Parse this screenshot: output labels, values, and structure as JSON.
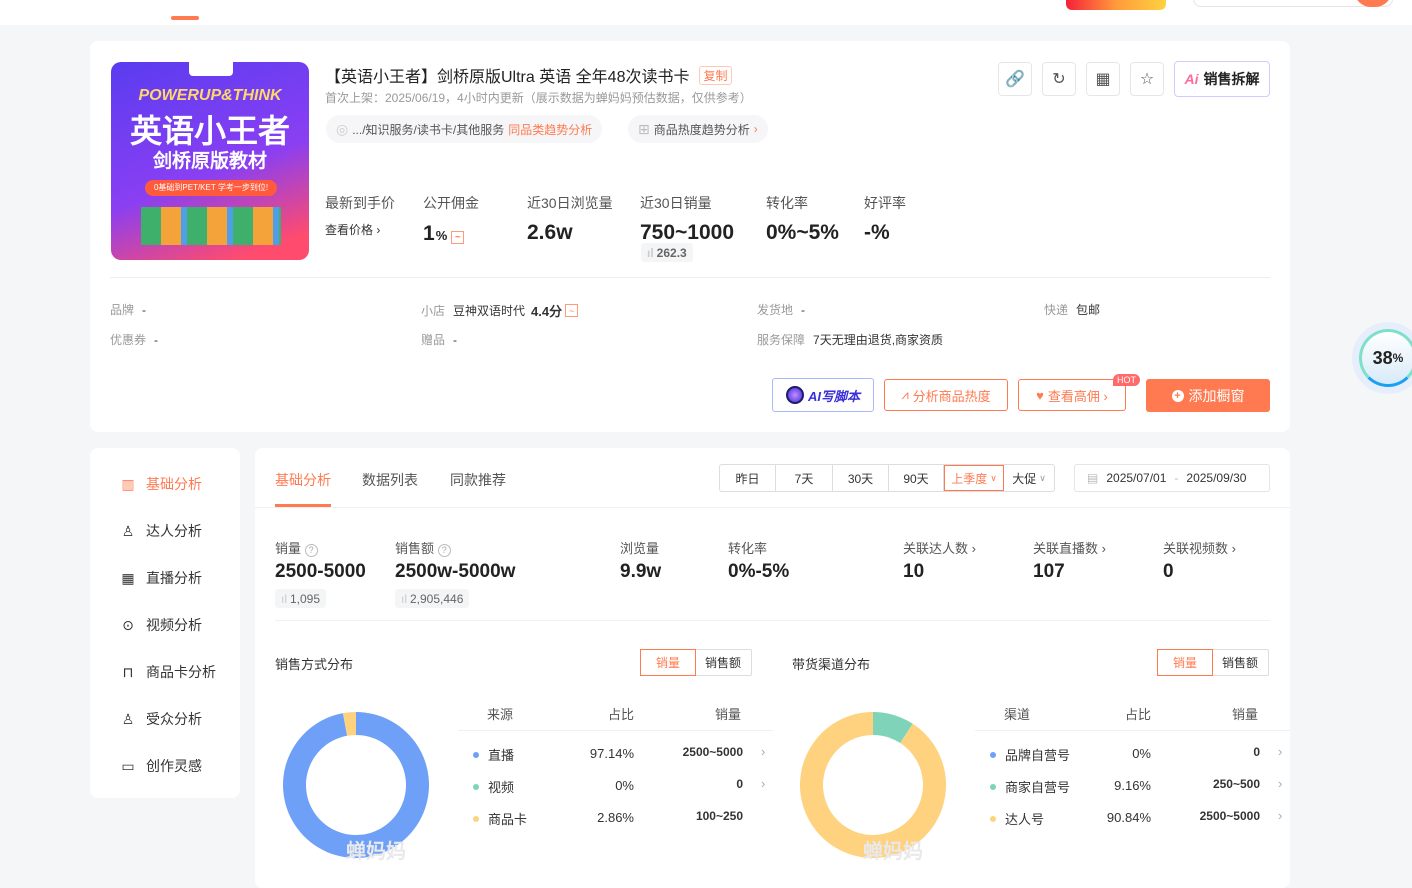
{
  "colors": {
    "accent": "#ff7a50",
    "blue": "#6fa0f8",
    "green": "#7fd3b8",
    "yellow": "#fed27f"
  },
  "product": {
    "title": "【英语小王者】剑桥原版Ultra 英语 全年48次读书卡",
    "copy_label": "复制",
    "subtitle": "首次上架：2025/06/19，4小时内更新（展示数据为蝉妈妈预估数据，仅供参考）",
    "category_path": ".../知识服务/读书卡/其他服务",
    "category_trend": "同品类趋势分析",
    "heat_trend": "商品热度趋势分析",
    "image_text": {
      "top": "POWERUP&THINK",
      "main": "英语小王者",
      "sub": "剑桥原版教材",
      "ribbon": "0基础到PET/KET 学考一步到位!"
    },
    "sales_breakdown_label": "销售拆解",
    "metrics": [
      {
        "label": "最新到手价",
        "value": "查看价格 ›"
      },
      {
        "label": "公开佣金",
        "value": "1",
        "unit": "%"
      },
      {
        "label": "近30日浏览量",
        "value": "2.6w"
      },
      {
        "label": "近30日销量",
        "value": "750~1000",
        "badge": "262.3"
      },
      {
        "label": "转化率",
        "value": "0%~5%"
      },
      {
        "label": "好评率",
        "value": "-%"
      }
    ],
    "info": {
      "brand": {
        "label": "品牌",
        "value": "-"
      },
      "shop": {
        "label": "小店",
        "value": "豆神双语时代",
        "score": "4.4分"
      },
      "ship_from": {
        "label": "发货地",
        "value": "-"
      },
      "express": {
        "label": "快递",
        "value": "包邮"
      },
      "coupon": {
        "label": "优惠券",
        "value": "-"
      },
      "gift": {
        "label": "赠品",
        "value": "-"
      },
      "guarantee": {
        "label": "服务保障",
        "value": "7天无理由退货,商家资质"
      }
    },
    "actions": {
      "ai_script": "AI写脚本",
      "analyze_heat": "分析商品热度",
      "view_high_comm": "查看高佣 ›",
      "hot_badge": "HOT",
      "add_window": "添加橱窗"
    }
  },
  "progress_widget": {
    "value": "38",
    "unit": "%"
  },
  "sidebar": {
    "items": [
      {
        "label": "基础分析",
        "icon": "bar-chart-icon",
        "active": true
      },
      {
        "label": "达人分析",
        "icon": "user-icon"
      },
      {
        "label": "直播分析",
        "icon": "live-icon"
      },
      {
        "label": "视频分析",
        "icon": "play-icon"
      },
      {
        "label": "商品卡分析",
        "icon": "bag-icon"
      },
      {
        "label": "受众分析",
        "icon": "audience-icon"
      },
      {
        "label": "创作灵感",
        "icon": "folder-icon"
      }
    ]
  },
  "main": {
    "tabs": [
      "基础分析",
      "数据列表",
      "同款推荐"
    ],
    "ranges": [
      "昨日",
      "7天",
      "30天",
      "90天",
      "上季度",
      "大促"
    ],
    "active_range": "上季度",
    "date_start": "2025/07/01",
    "date_sep": "-",
    "date_end": "2025/09/30",
    "stats": [
      {
        "label": "销量",
        "value": "2500-5000",
        "badge": "1,095"
      },
      {
        "label": "销售额",
        "value": "2500w-5000w",
        "badge": "2,905,446"
      },
      {
        "label": "浏览量",
        "value": "9.9w"
      },
      {
        "label": "转化率",
        "value": "0%-5%"
      },
      {
        "label": "关联达人数 ›",
        "value": "10"
      },
      {
        "label": "关联直播数 ›",
        "value": "107"
      },
      {
        "label": "关联视频数 ›",
        "value": "0"
      }
    ],
    "toggle": [
      "销量",
      "销售额"
    ],
    "watermark": "蝉妈妈"
  },
  "chart_data": [
    {
      "type": "pie",
      "title": "销售方式分布",
      "columns": [
        "来源",
        "占比",
        "销量"
      ],
      "slices": [
        {
          "name": "直播",
          "percent": 97.14,
          "sales": "2500~5000",
          "color": "#6fa0f8"
        },
        {
          "name": "视频",
          "percent": 0,
          "sales": "0",
          "color": "#7fd3b8"
        },
        {
          "name": "商品卡",
          "percent": 2.86,
          "sales": "100~250",
          "color": "#fed27f"
        }
      ],
      "pct_labels": [
        "97.14%",
        "0%",
        "2.86%"
      ]
    },
    {
      "type": "pie",
      "title": "带货渠道分布",
      "columns": [
        "渠道",
        "占比",
        "销量"
      ],
      "slices": [
        {
          "name": "品牌自营号",
          "percent": 0,
          "sales": "0",
          "color": "#6fa0f8"
        },
        {
          "name": "商家自营号",
          "percent": 9.16,
          "sales": "250~500",
          "color": "#7fd3b8"
        },
        {
          "name": "达人号",
          "percent": 90.84,
          "sales": "2500~5000",
          "color": "#fed27f"
        }
      ],
      "pct_labels": [
        "0%",
        "9.16%",
        "90.84%"
      ]
    }
  ]
}
